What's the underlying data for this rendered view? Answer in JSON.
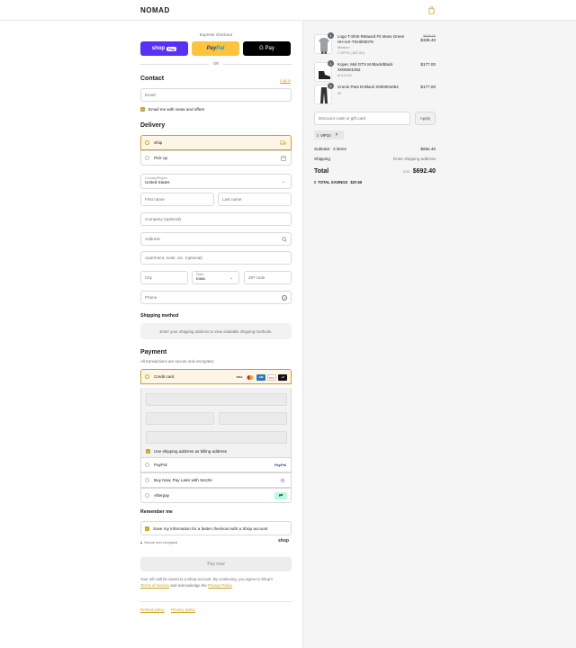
{
  "header": {
    "brand": "NOMAD"
  },
  "express": {
    "label": "Express checkout",
    "shop_pay": "shop",
    "shop_pay_pill": "Pay",
    "paypal_a": "Pay",
    "paypal_b": "Pal",
    "gpay": "G Pay",
    "or": "OR"
  },
  "contact": {
    "title": "Contact",
    "login": "Log in",
    "email_placeholder": "Email",
    "news_label": "Email me with news and offers"
  },
  "delivery": {
    "title": "Delivery",
    "ship": "Ship",
    "pickup": "Pick up",
    "country_label": "Country/Region",
    "country_value": "United States",
    "first_name": "First name",
    "last_name": "Last name",
    "company": "Company (optional)",
    "address": "Address",
    "apartment": "Apartment, suite, etc. (optional)",
    "city": "City",
    "state_label": "State",
    "state_value": "Iowa",
    "zip": "ZIP code",
    "phone": "Phone"
  },
  "shipping_method": {
    "title": "Shipping method",
    "message": "Enter your shipping address to view available shipping methods."
  },
  "payment": {
    "title": "Payment",
    "subtitle": "All transactions are secure and encrypted.",
    "credit_card": "Credit card",
    "card_more": "+3",
    "use_shipping": "Use shipping address as billing address",
    "paypal": "PayPal",
    "sezzle": "Buy Now, Pay Later with Sezzle",
    "afterpay": "Afterpay"
  },
  "remember": {
    "title": "Remember me",
    "save_label": "Save my information for a faster checkout with a Shop account",
    "secure": "Secure and encrypted",
    "shop": "shop"
  },
  "pay_now": "Pay now",
  "legal": {
    "line1": "Your info will be saved to a Shop account. By continuing, you agree to Shop's",
    "terms": "Terms of Service",
    "and": " and acknowledge the ",
    "privacy": "Privacy Policy",
    "period": "."
  },
  "footer": {
    "refund": "Refund policy",
    "privacy": "Privacy policy"
  },
  "cart": {
    "items": [
      {
        "qty": "1",
        "name": "Logo T-Shirt Relaxed Fit Moss Green HH-UX-TSH000079",
        "variant": "Medium",
        "promo": "VIP10 (-$37.60)",
        "old_price": "$376.00",
        "price": "$338.40"
      },
      {
        "qty": "1",
        "name": "Koper, Mid GTX M Black/Black X000001002",
        "variant": "M 8.5 US",
        "price": "$177.00"
      },
      {
        "qty": "1",
        "name": "Cronin Pant M Black X000001054",
        "variant": "30",
        "price": "$177.00"
      }
    ],
    "discount_placeholder": "Discount code or gift card",
    "apply": "Apply",
    "tag": "VIP10",
    "subtotal_label": "Subtotal · 3 items",
    "subtotal": "$692.40",
    "shipping_label": "Shipping",
    "shipping_value": "Enter shipping address",
    "total_label": "Total",
    "currency": "USD",
    "total": "$692.40",
    "savings_label": "TOTAL SAVINGS",
    "savings": "$37.60"
  },
  "colors": {
    "accent": "#c9a227",
    "shop_purple": "#5a31f4",
    "paypal_yellow": "#ffc439"
  }
}
